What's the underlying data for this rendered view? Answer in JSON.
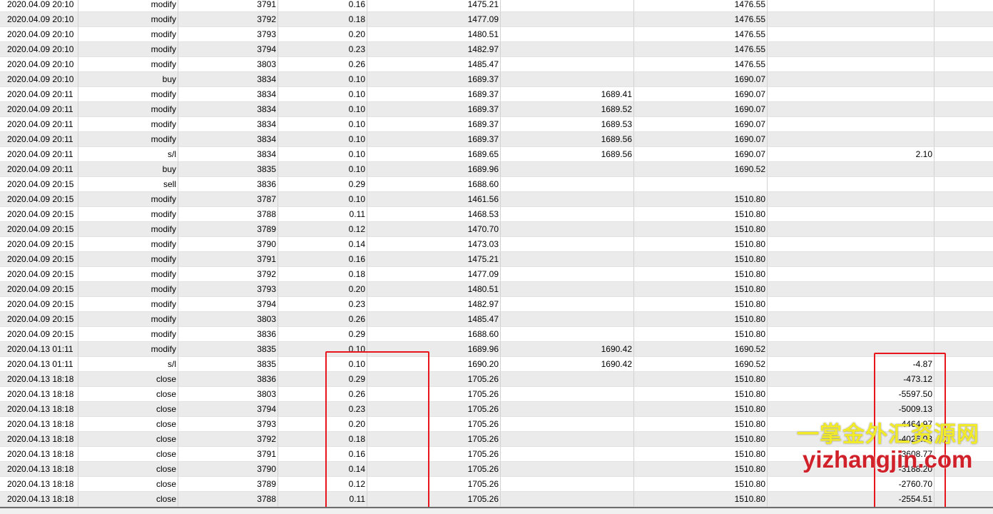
{
  "rows": [
    {
      "time": "2020.04.09 20:10",
      "type": "modify",
      "order": "3791",
      "size": "0.16",
      "price": "1475.21",
      "sl": "",
      "tp": "1476.55",
      "profit": ""
    },
    {
      "time": "2020.04.09 20:10",
      "type": "modify",
      "order": "3792",
      "size": "0.18",
      "price": "1477.09",
      "sl": "",
      "tp": "1476.55",
      "profit": ""
    },
    {
      "time": "2020.04.09 20:10",
      "type": "modify",
      "order": "3793",
      "size": "0.20",
      "price": "1480.51",
      "sl": "",
      "tp": "1476.55",
      "profit": ""
    },
    {
      "time": "2020.04.09 20:10",
      "type": "modify",
      "order": "3794",
      "size": "0.23",
      "price": "1482.97",
      "sl": "",
      "tp": "1476.55",
      "profit": ""
    },
    {
      "time": "2020.04.09 20:10",
      "type": "modify",
      "order": "3803",
      "size": "0.26",
      "price": "1485.47",
      "sl": "",
      "tp": "1476.55",
      "profit": ""
    },
    {
      "time": "2020.04.09 20:10",
      "type": "buy",
      "order": "3834",
      "size": "0.10",
      "price": "1689.37",
      "sl": "",
      "tp": "1690.07",
      "profit": ""
    },
    {
      "time": "2020.04.09 20:11",
      "type": "modify",
      "order": "3834",
      "size": "0.10",
      "price": "1689.37",
      "sl": "1689.41",
      "tp": "1690.07",
      "profit": ""
    },
    {
      "time": "2020.04.09 20:11",
      "type": "modify",
      "order": "3834",
      "size": "0.10",
      "price": "1689.37",
      "sl": "1689.52",
      "tp": "1690.07",
      "profit": ""
    },
    {
      "time": "2020.04.09 20:11",
      "type": "modify",
      "order": "3834",
      "size": "0.10",
      "price": "1689.37",
      "sl": "1689.53",
      "tp": "1690.07",
      "profit": ""
    },
    {
      "time": "2020.04.09 20:11",
      "type": "modify",
      "order": "3834",
      "size": "0.10",
      "price": "1689.37",
      "sl": "1689.56",
      "tp": "1690.07",
      "profit": ""
    },
    {
      "time": "2020.04.09 20:11",
      "type": "s/l",
      "order": "3834",
      "size": "0.10",
      "price": "1689.65",
      "sl": "1689.56",
      "tp": "1690.07",
      "profit": "2.10"
    },
    {
      "time": "2020.04.09 20:11",
      "type": "buy",
      "order": "3835",
      "size": "0.10",
      "price": "1689.96",
      "sl": "",
      "tp": "1690.52",
      "profit": ""
    },
    {
      "time": "2020.04.09 20:15",
      "type": "sell",
      "order": "3836",
      "size": "0.29",
      "price": "1688.60",
      "sl": "",
      "tp": "",
      "profit": ""
    },
    {
      "time": "2020.04.09 20:15",
      "type": "modify",
      "order": "3787",
      "size": "0.10",
      "price": "1461.56",
      "sl": "",
      "tp": "1510.80",
      "profit": ""
    },
    {
      "time": "2020.04.09 20:15",
      "type": "modify",
      "order": "3788",
      "size": "0.11",
      "price": "1468.53",
      "sl": "",
      "tp": "1510.80",
      "profit": ""
    },
    {
      "time": "2020.04.09 20:15",
      "type": "modify",
      "order": "3789",
      "size": "0.12",
      "price": "1470.70",
      "sl": "",
      "tp": "1510.80",
      "profit": ""
    },
    {
      "time": "2020.04.09 20:15",
      "type": "modify",
      "order": "3790",
      "size": "0.14",
      "price": "1473.03",
      "sl": "",
      "tp": "1510.80",
      "profit": ""
    },
    {
      "time": "2020.04.09 20:15",
      "type": "modify",
      "order": "3791",
      "size": "0.16",
      "price": "1475.21",
      "sl": "",
      "tp": "1510.80",
      "profit": ""
    },
    {
      "time": "2020.04.09 20:15",
      "type": "modify",
      "order": "3792",
      "size": "0.18",
      "price": "1477.09",
      "sl": "",
      "tp": "1510.80",
      "profit": ""
    },
    {
      "time": "2020.04.09 20:15",
      "type": "modify",
      "order": "3793",
      "size": "0.20",
      "price": "1480.51",
      "sl": "",
      "tp": "1510.80",
      "profit": ""
    },
    {
      "time": "2020.04.09 20:15",
      "type": "modify",
      "order": "3794",
      "size": "0.23",
      "price": "1482.97",
      "sl": "",
      "tp": "1510.80",
      "profit": ""
    },
    {
      "time": "2020.04.09 20:15",
      "type": "modify",
      "order": "3803",
      "size": "0.26",
      "price": "1485.47",
      "sl": "",
      "tp": "1510.80",
      "profit": ""
    },
    {
      "time": "2020.04.09 20:15",
      "type": "modify",
      "order": "3836",
      "size": "0.29",
      "price": "1688.60",
      "sl": "",
      "tp": "1510.80",
      "profit": ""
    },
    {
      "time": "2020.04.13 01:11",
      "type": "modify",
      "order": "3835",
      "size": "0.10",
      "price": "1689.96",
      "sl": "1690.42",
      "tp": "1690.52",
      "profit": ""
    },
    {
      "time": "2020.04.13 01:11",
      "type": "s/l",
      "order": "3835",
      "size": "0.10",
      "price": "1690.20",
      "sl": "1690.42",
      "tp": "1690.52",
      "profit": "-4.87"
    },
    {
      "time": "2020.04.13 18:18",
      "type": "close",
      "order": "3836",
      "size": "0.29",
      "price": "1705.26",
      "sl": "",
      "tp": "1510.80",
      "profit": "-473.12"
    },
    {
      "time": "2020.04.13 18:18",
      "type": "close",
      "order": "3803",
      "size": "0.26",
      "price": "1705.26",
      "sl": "",
      "tp": "1510.80",
      "profit": "-5597.50"
    },
    {
      "time": "2020.04.13 18:18",
      "type": "close",
      "order": "3794",
      "size": "0.23",
      "price": "1705.26",
      "sl": "",
      "tp": "1510.80",
      "profit": "-5009.13"
    },
    {
      "time": "2020.04.13 18:18",
      "type": "close",
      "order": "3793",
      "size": "0.20",
      "price": "1705.26",
      "sl": "",
      "tp": "1510.80",
      "profit": "-4464.97"
    },
    {
      "time": "2020.04.13 18:18",
      "type": "close",
      "order": "3792",
      "size": "0.18",
      "price": "1705.26",
      "sl": "",
      "tp": "1510.80",
      "profit": "-4026.03"
    },
    {
      "time": "2020.04.13 18:18",
      "type": "close",
      "order": "3791",
      "size": "0.16",
      "price": "1705.26",
      "sl": "",
      "tp": "1510.80",
      "profit": "-3608.77"
    },
    {
      "time": "2020.04.13 18:18",
      "type": "close",
      "order": "3790",
      "size": "0.14",
      "price": "1705.26",
      "sl": "",
      "tp": "1510.80",
      "profit": "-3188.20"
    },
    {
      "time": "2020.04.13 18:18",
      "type": "close",
      "order": "3789",
      "size": "0.12",
      "price": "1705.26",
      "sl": "",
      "tp": "1510.80",
      "profit": "-2760.70"
    },
    {
      "time": "2020.04.13 18:18",
      "type": "close",
      "order": "3788",
      "size": "0.11",
      "price": "1705.26",
      "sl": "",
      "tp": "1510.80",
      "profit": "-2554.51"
    }
  ],
  "watermark": {
    "line1": "一掌金外汇资源网",
    "line2": "yizhangjin.com",
    "line1_color": "#f0ea2a",
    "line2_color": "#d0202a"
  },
  "highlight_color": "#e8161c"
}
